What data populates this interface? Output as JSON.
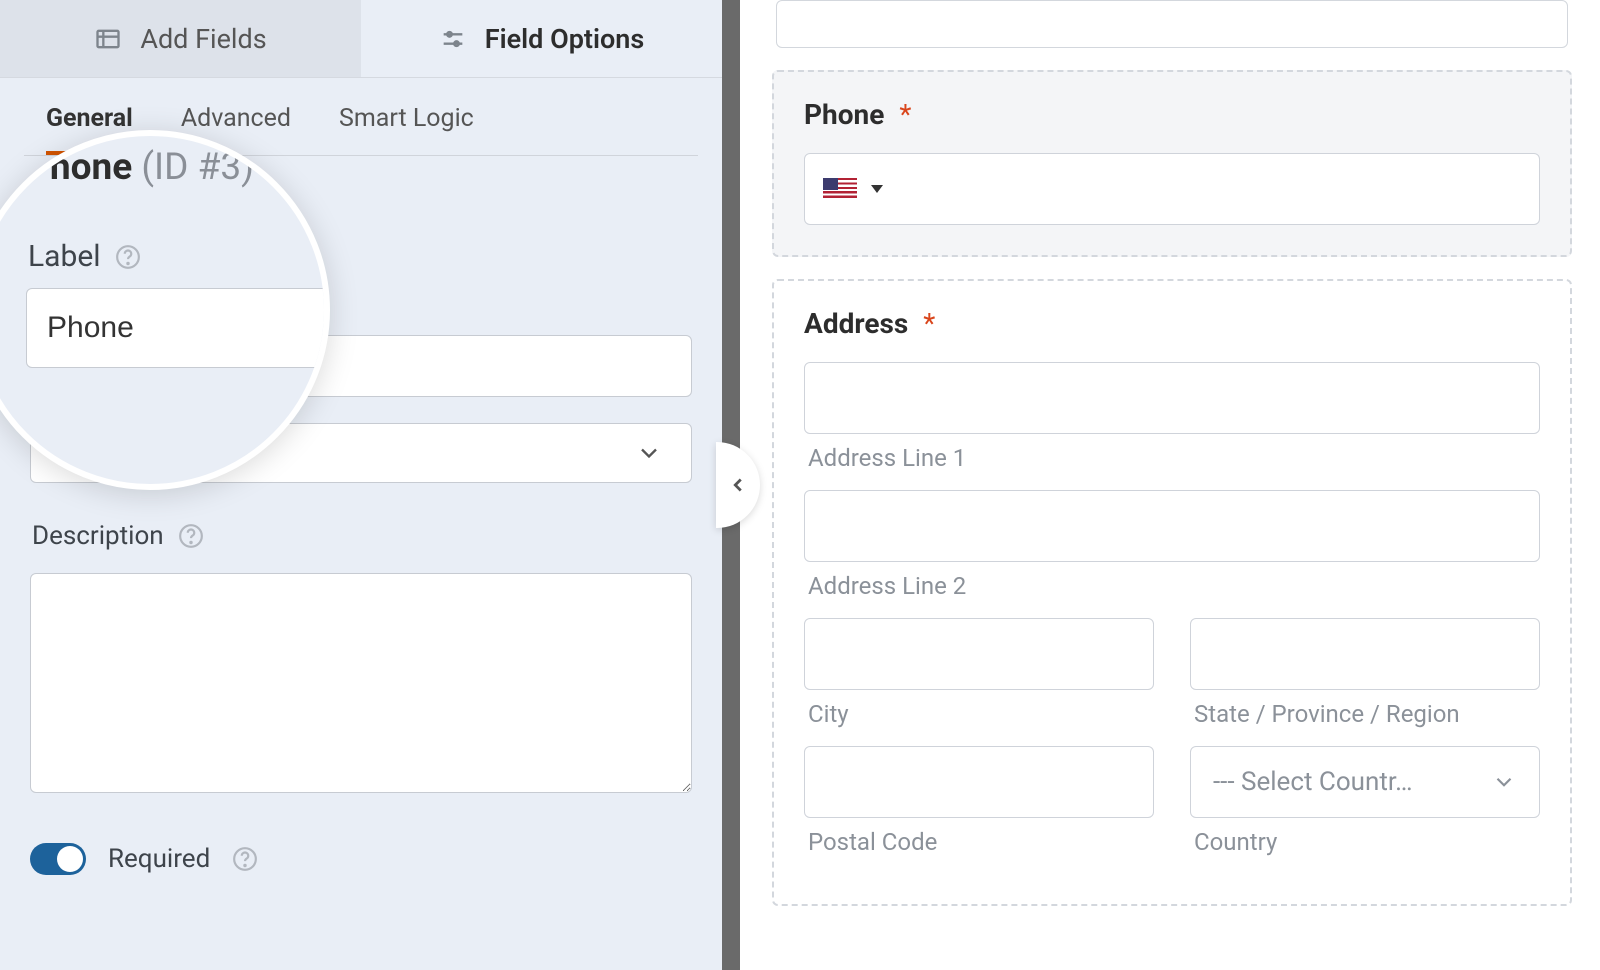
{
  "panel_tabs": {
    "add_fields": "Add Fields",
    "field_options": "Field Options"
  },
  "sub_tabs": {
    "general": "General",
    "advanced": "Advanced",
    "smart_logic": "Smart Logic"
  },
  "field_options": {
    "heading_name": "Phone",
    "heading_id": "(ID #3)",
    "label_label": "Label",
    "label_value": "Phone",
    "description_label": "Description",
    "description_value": "",
    "required_label": "Required",
    "required_on": true
  },
  "preview": {
    "phone": {
      "label": "Phone",
      "required": "*"
    },
    "address": {
      "label": "Address",
      "required": "*",
      "line1": "Address Line 1",
      "line2": "Address Line 2",
      "city": "City",
      "state": "State / Province / Region",
      "postal": "Postal Code",
      "country": "Country",
      "country_placeholder": "--- Select Countr…"
    }
  }
}
